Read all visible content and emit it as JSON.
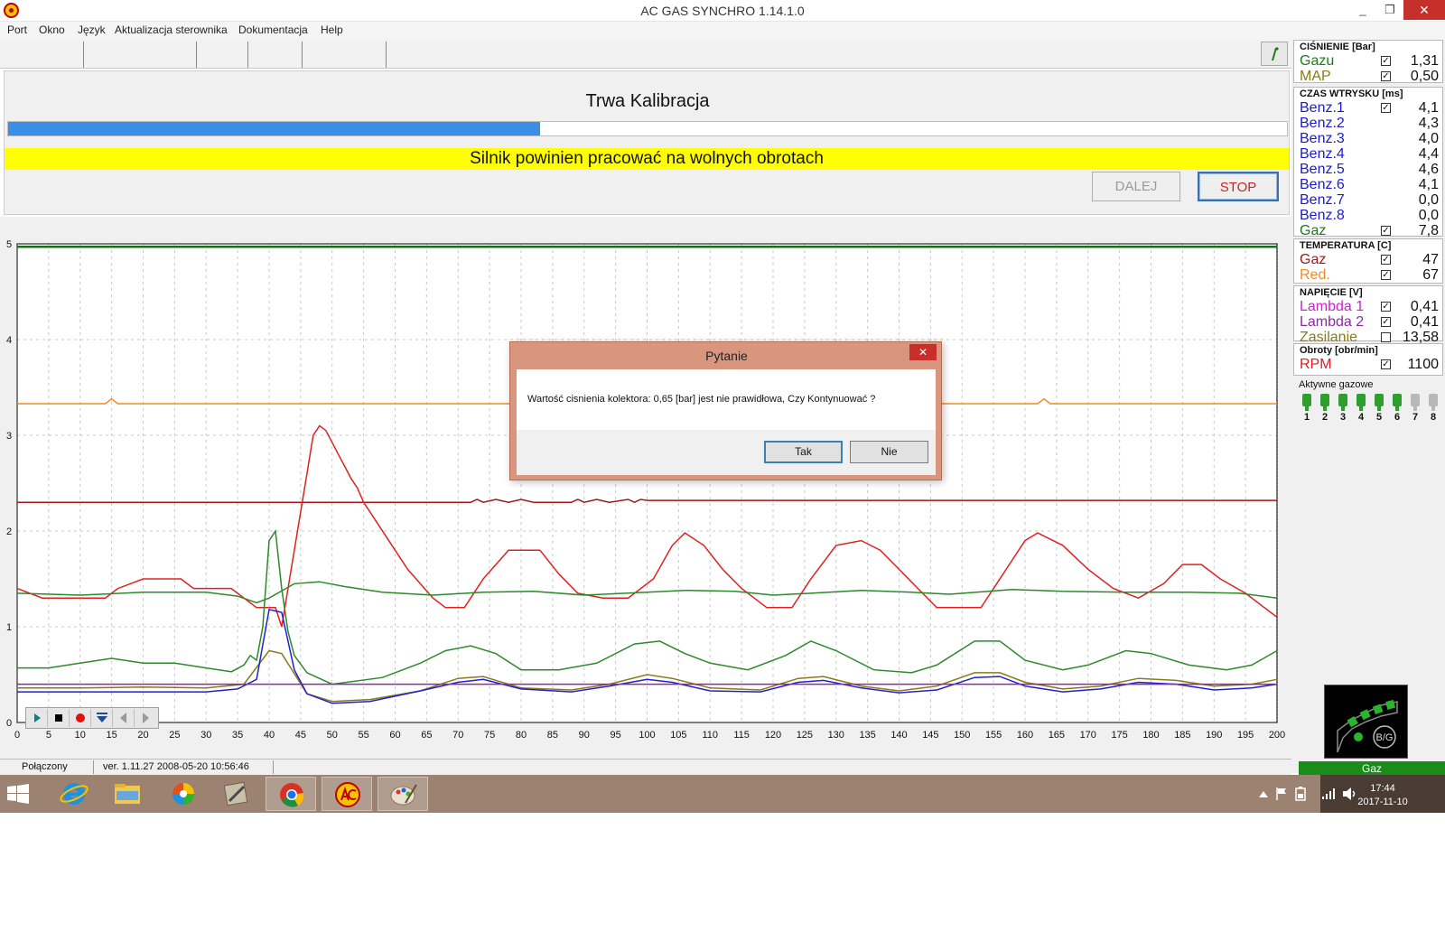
{
  "window": {
    "title": "AC GAS SYNCHRO     1.14.1.0",
    "min": "_",
    "max": "❐",
    "close": "✕"
  },
  "menu": [
    "Port",
    "Okno",
    "Język",
    "Aktualizacja sterownika",
    "Dokumentacja",
    "Help"
  ],
  "calibration": {
    "title": "Trwa Kalibracja",
    "progress_fraction": 0.416,
    "warning": "Silnik powinien pracować na wolnych obrotach",
    "next_label": "DALEJ",
    "stop_label": "STOP"
  },
  "chart_data": {
    "type": "line",
    "xlim": [
      0,
      200
    ],
    "ylim": [
      0,
      5
    ],
    "x_ticks": [
      0,
      5,
      10,
      15,
      20,
      25,
      30,
      35,
      40,
      45,
      50,
      55,
      60,
      65,
      70,
      75,
      80,
      85,
      90,
      95,
      100,
      105,
      110,
      115,
      120,
      125,
      130,
      135,
      140,
      145,
      150,
      155,
      160,
      165,
      170,
      175,
      180,
      185,
      190,
      195,
      200
    ],
    "y_ticks": [
      0,
      1,
      2,
      3,
      4,
      5
    ],
    "grid": true,
    "series": [
      {
        "color": "#1a6e1a",
        "points": [
          [
            0,
            4.97
          ],
          [
            200,
            4.97
          ]
        ]
      },
      {
        "color": "#f08a2a",
        "points": [
          [
            0,
            3.33
          ],
          [
            14,
            3.33
          ],
          [
            15,
            3.38
          ],
          [
            16,
            3.33
          ],
          [
            162,
            3.33
          ],
          [
            163,
            3.38
          ],
          [
            164,
            3.33
          ],
          [
            200,
            3.33
          ]
        ]
      },
      {
        "color": "#a01818",
        "points": [
          [
            0,
            2.3
          ],
          [
            72,
            2.3
          ],
          [
            73,
            2.33
          ],
          [
            74,
            2.3
          ],
          [
            76,
            2.33
          ],
          [
            78,
            2.3
          ],
          [
            80,
            2.33
          ],
          [
            82,
            2.3
          ],
          [
            88,
            2.3
          ],
          [
            89,
            2.33
          ],
          [
            90,
            2.3
          ],
          [
            92,
            2.33
          ],
          [
            94,
            2.3
          ],
          [
            97,
            2.33
          ],
          [
            98,
            2.3
          ],
          [
            99,
            2.33
          ],
          [
            100,
            2.32
          ],
          [
            200,
            2.32
          ]
        ]
      },
      {
        "color": "#e02020",
        "points": [
          [
            0,
            1.4
          ],
          [
            4,
            1.3
          ],
          [
            14,
            1.3
          ],
          [
            16,
            1.4
          ],
          [
            20,
            1.5
          ],
          [
            26,
            1.5
          ],
          [
            28,
            1.4
          ],
          [
            34,
            1.4
          ],
          [
            38,
            1.2
          ],
          [
            41,
            1.2
          ],
          [
            42,
            1.0
          ],
          [
            44,
            1.8
          ],
          [
            46,
            2.6
          ],
          [
            47,
            3.0
          ],
          [
            48,
            3.1
          ],
          [
            49,
            3.05
          ],
          [
            51,
            2.8
          ],
          [
            53,
            2.55
          ],
          [
            54,
            2.45
          ],
          [
            55,
            2.3
          ],
          [
            57,
            2.1
          ],
          [
            62,
            1.6
          ],
          [
            66,
            1.3
          ],
          [
            68,
            1.2
          ],
          [
            71,
            1.2
          ],
          [
            74,
            1.5
          ],
          [
            78,
            1.8
          ],
          [
            83,
            1.8
          ],
          [
            86,
            1.55
          ],
          [
            89,
            1.35
          ],
          [
            93,
            1.3
          ],
          [
            97,
            1.3
          ],
          [
            101,
            1.5
          ],
          [
            104,
            1.85
          ],
          [
            106,
            1.98
          ],
          [
            109,
            1.85
          ],
          [
            112,
            1.6
          ],
          [
            115,
            1.4
          ],
          [
            119,
            1.2
          ],
          [
            123,
            1.2
          ],
          [
            126,
            1.5
          ],
          [
            130,
            1.85
          ],
          [
            134,
            1.9
          ],
          [
            137,
            1.8
          ],
          [
            140,
            1.6
          ],
          [
            143,
            1.4
          ],
          [
            146,
            1.2
          ],
          [
            153,
            1.2
          ],
          [
            157,
            1.6
          ],
          [
            160,
            1.9
          ],
          [
            162,
            1.98
          ],
          [
            166,
            1.85
          ],
          [
            170,
            1.6
          ],
          [
            174,
            1.4
          ],
          [
            178,
            1.3
          ],
          [
            182,
            1.45
          ],
          [
            185,
            1.65
          ],
          [
            188,
            1.65
          ],
          [
            191,
            1.5
          ],
          [
            195,
            1.35
          ],
          [
            198,
            1.2
          ],
          [
            200,
            1.1
          ]
        ]
      },
      {
        "color": "#2b8a2b",
        "points": [
          [
            0,
            1.35
          ],
          [
            10,
            1.33
          ],
          [
            20,
            1.36
          ],
          [
            30,
            1.36
          ],
          [
            35,
            1.32
          ],
          [
            38,
            1.25
          ],
          [
            40,
            1.3
          ],
          [
            44,
            1.45
          ],
          [
            48,
            1.47
          ],
          [
            52,
            1.42
          ],
          [
            58,
            1.36
          ],
          [
            66,
            1.33
          ],
          [
            74,
            1.36
          ],
          [
            82,
            1.37
          ],
          [
            90,
            1.33
          ],
          [
            100,
            1.36
          ],
          [
            106,
            1.38
          ],
          [
            114,
            1.37
          ],
          [
            120,
            1.33
          ],
          [
            126,
            1.35
          ],
          [
            134,
            1.38
          ],
          [
            142,
            1.36
          ],
          [
            148,
            1.34
          ],
          [
            158,
            1.39
          ],
          [
            166,
            1.37
          ],
          [
            176,
            1.36
          ],
          [
            186,
            1.36
          ],
          [
            194,
            1.35
          ],
          [
            200,
            1.3
          ]
        ]
      },
      {
        "color": "#2b8a2b",
        "points": [
          [
            0,
            0.57
          ],
          [
            5,
            0.57
          ],
          [
            10,
            0.62
          ],
          [
            15,
            0.67
          ],
          [
            20,
            0.62
          ],
          [
            25,
            0.62
          ],
          [
            30,
            0.57
          ],
          [
            34,
            0.53
          ],
          [
            36,
            0.6
          ],
          [
            37,
            0.7
          ],
          [
            38,
            0.65
          ],
          [
            39,
            1.0
          ],
          [
            40,
            1.9
          ],
          [
            41,
            2.0
          ],
          [
            42,
            1.4
          ],
          [
            43,
            0.95
          ],
          [
            44,
            0.7
          ],
          [
            46,
            0.52
          ],
          [
            50,
            0.4
          ],
          [
            58,
            0.47
          ],
          [
            64,
            0.62
          ],
          [
            68,
            0.75
          ],
          [
            72,
            0.8
          ],
          [
            76,
            0.72
          ],
          [
            80,
            0.55
          ],
          [
            86,
            0.55
          ],
          [
            92,
            0.62
          ],
          [
            98,
            0.82
          ],
          [
            102,
            0.85
          ],
          [
            106,
            0.72
          ],
          [
            110,
            0.62
          ],
          [
            116,
            0.55
          ],
          [
            122,
            0.7
          ],
          [
            126,
            0.85
          ],
          [
            130,
            0.75
          ],
          [
            136,
            0.55
          ],
          [
            142,
            0.52
          ],
          [
            146,
            0.6
          ],
          [
            152,
            0.85
          ],
          [
            156,
            0.85
          ],
          [
            160,
            0.65
          ],
          [
            166,
            0.55
          ],
          [
            170,
            0.6
          ],
          [
            176,
            0.75
          ],
          [
            180,
            0.72
          ],
          [
            186,
            0.6
          ],
          [
            192,
            0.55
          ],
          [
            196,
            0.6
          ],
          [
            200,
            0.75
          ]
        ]
      },
      {
        "color": "#8a7a1a",
        "points": [
          [
            0,
            0.36
          ],
          [
            10,
            0.36
          ],
          [
            20,
            0.37
          ],
          [
            30,
            0.36
          ],
          [
            36,
            0.4
          ],
          [
            40,
            0.75
          ],
          [
            42,
            0.72
          ],
          [
            46,
            0.3
          ],
          [
            50,
            0.22
          ],
          [
            56,
            0.24
          ],
          [
            64,
            0.33
          ],
          [
            70,
            0.46
          ],
          [
            74,
            0.48
          ],
          [
            80,
            0.36
          ],
          [
            88,
            0.34
          ],
          [
            94,
            0.4
          ],
          [
            100,
            0.5
          ],
          [
            104,
            0.46
          ],
          [
            110,
            0.36
          ],
          [
            118,
            0.34
          ],
          [
            124,
            0.46
          ],
          [
            128,
            0.48
          ],
          [
            134,
            0.38
          ],
          [
            140,
            0.33
          ],
          [
            146,
            0.38
          ],
          [
            152,
            0.52
          ],
          [
            156,
            0.52
          ],
          [
            160,
            0.42
          ],
          [
            166,
            0.35
          ],
          [
            172,
            0.38
          ],
          [
            178,
            0.46
          ],
          [
            184,
            0.44
          ],
          [
            190,
            0.38
          ],
          [
            196,
            0.4
          ],
          [
            200,
            0.45
          ]
        ]
      },
      {
        "color": "#2020d0",
        "points": [
          [
            0,
            0.32
          ],
          [
            10,
            0.32
          ],
          [
            20,
            0.32
          ],
          [
            30,
            0.32
          ],
          [
            35,
            0.35
          ],
          [
            38,
            0.45
          ],
          [
            40,
            1.18
          ],
          [
            42,
            1.15
          ],
          [
            44,
            0.55
          ],
          [
            46,
            0.3
          ],
          [
            50,
            0.2
          ],
          [
            56,
            0.22
          ],
          [
            64,
            0.33
          ],
          [
            70,
            0.42
          ],
          [
            74,
            0.45
          ],
          [
            80,
            0.35
          ],
          [
            88,
            0.32
          ],
          [
            94,
            0.38
          ],
          [
            100,
            0.45
          ],
          [
            104,
            0.42
          ],
          [
            110,
            0.33
          ],
          [
            118,
            0.32
          ],
          [
            124,
            0.42
          ],
          [
            128,
            0.44
          ],
          [
            134,
            0.36
          ],
          [
            140,
            0.31
          ],
          [
            146,
            0.34
          ],
          [
            152,
            0.47
          ],
          [
            156,
            0.48
          ],
          [
            160,
            0.38
          ],
          [
            166,
            0.32
          ],
          [
            172,
            0.35
          ],
          [
            178,
            0.42
          ],
          [
            184,
            0.4
          ],
          [
            190,
            0.34
          ],
          [
            196,
            0.36
          ],
          [
            200,
            0.4
          ]
        ]
      },
      {
        "color": "#8a2aa0",
        "points": [
          [
            0,
            0.4
          ],
          [
            200,
            0.4
          ]
        ]
      }
    ]
  },
  "right_panel": {
    "pressure": {
      "title": "CIŚNIENIE [Bar]",
      "rows": [
        {
          "label": "Gazu",
          "color": "#1a7a1a",
          "checked": true,
          "check": "✓",
          "value": "1,31"
        },
        {
          "label": "MAP",
          "color": "#8a7a1a",
          "checked": true,
          "check": "✓",
          "value": "0,50"
        }
      ]
    },
    "injection": {
      "title": "CZAS WTRYSKU  [ms]",
      "rows": [
        {
          "label": "Benz.1",
          "color": "#1a1ad0",
          "checked": true,
          "check": "✓",
          "value": "4,1"
        },
        {
          "label": "Benz.2",
          "color": "#1a1ad0",
          "checked": false,
          "check": "",
          "value": "4,3"
        },
        {
          "label": "Benz.3",
          "color": "#1a1ad0",
          "checked": false,
          "check": "",
          "value": "4,0"
        },
        {
          "label": "Benz.4",
          "color": "#1a1ad0",
          "checked": false,
          "check": "",
          "value": "4,4"
        },
        {
          "label": "Benz.5",
          "color": "#1a1ad0",
          "checked": false,
          "check": "",
          "value": "4,6"
        },
        {
          "label": "Benz.6",
          "color": "#1a1ad0",
          "checked": false,
          "check": "",
          "value": "4,1"
        },
        {
          "label": "Benz.7",
          "color": "#1a1ad0",
          "checked": false,
          "check": "",
          "value": "0,0"
        },
        {
          "label": "Benz.8",
          "color": "#1a1ad0",
          "checked": false,
          "check": "",
          "value": "0,0"
        },
        {
          "label": "Gaz",
          "color": "#1a7a1a",
          "checked": true,
          "check": "✓",
          "value": "7,8"
        }
      ]
    },
    "temperature": {
      "title": "TEMPERATURA  [C]",
      "rows": [
        {
          "label": "Gaz",
          "color": "#a01818",
          "checked": true,
          "check": "✓",
          "value": "47"
        },
        {
          "label": "Red.",
          "color": "#f08a2a",
          "checked": true,
          "check": "✓",
          "value": "67"
        }
      ]
    },
    "voltage": {
      "title": "NAPIĘCIE  [V]",
      "rows": [
        {
          "label": "Lambda 1",
          "color": "#d020d0",
          "checked": true,
          "check": "✓",
          "value": "0,41"
        },
        {
          "label": "Lambda 2",
          "color": "#8a2aa0",
          "checked": true,
          "check": "✓",
          "value": "0,41"
        },
        {
          "label": "Zasilanie",
          "color": "#8a7a1a",
          "checked": false,
          "check": "",
          "value": "13,58"
        }
      ]
    },
    "rpm": {
      "title": "Obroty [obr/min]",
      "rows": [
        {
          "label": "RPM",
          "color": "#e02020",
          "checked": true,
          "check": "✓",
          "value": "1100"
        }
      ]
    },
    "injectors": {
      "title": "Aktywne gazowe",
      "numbers": [
        "1",
        "2",
        "3",
        "4",
        "5",
        "6",
        "7",
        "8"
      ],
      "active": [
        true,
        true,
        true,
        true,
        true,
        true,
        false,
        false
      ]
    },
    "bg_label": "B/G"
  },
  "status": {
    "connection": "Połączony",
    "version": "ver. 1.11.27   2008-05-20  10:56:46",
    "mode": "Gaz"
  },
  "taskbar": {
    "time": "17:44",
    "date": "2017-11-10"
  },
  "dialog": {
    "title": "Pytanie",
    "close": "✕",
    "message": "Wartość cisnienia kolektora: 0,65 [bar] jest nie prawidłowa, Czy Kontynuować ?",
    "yes": "Tak",
    "no": "Nie"
  }
}
